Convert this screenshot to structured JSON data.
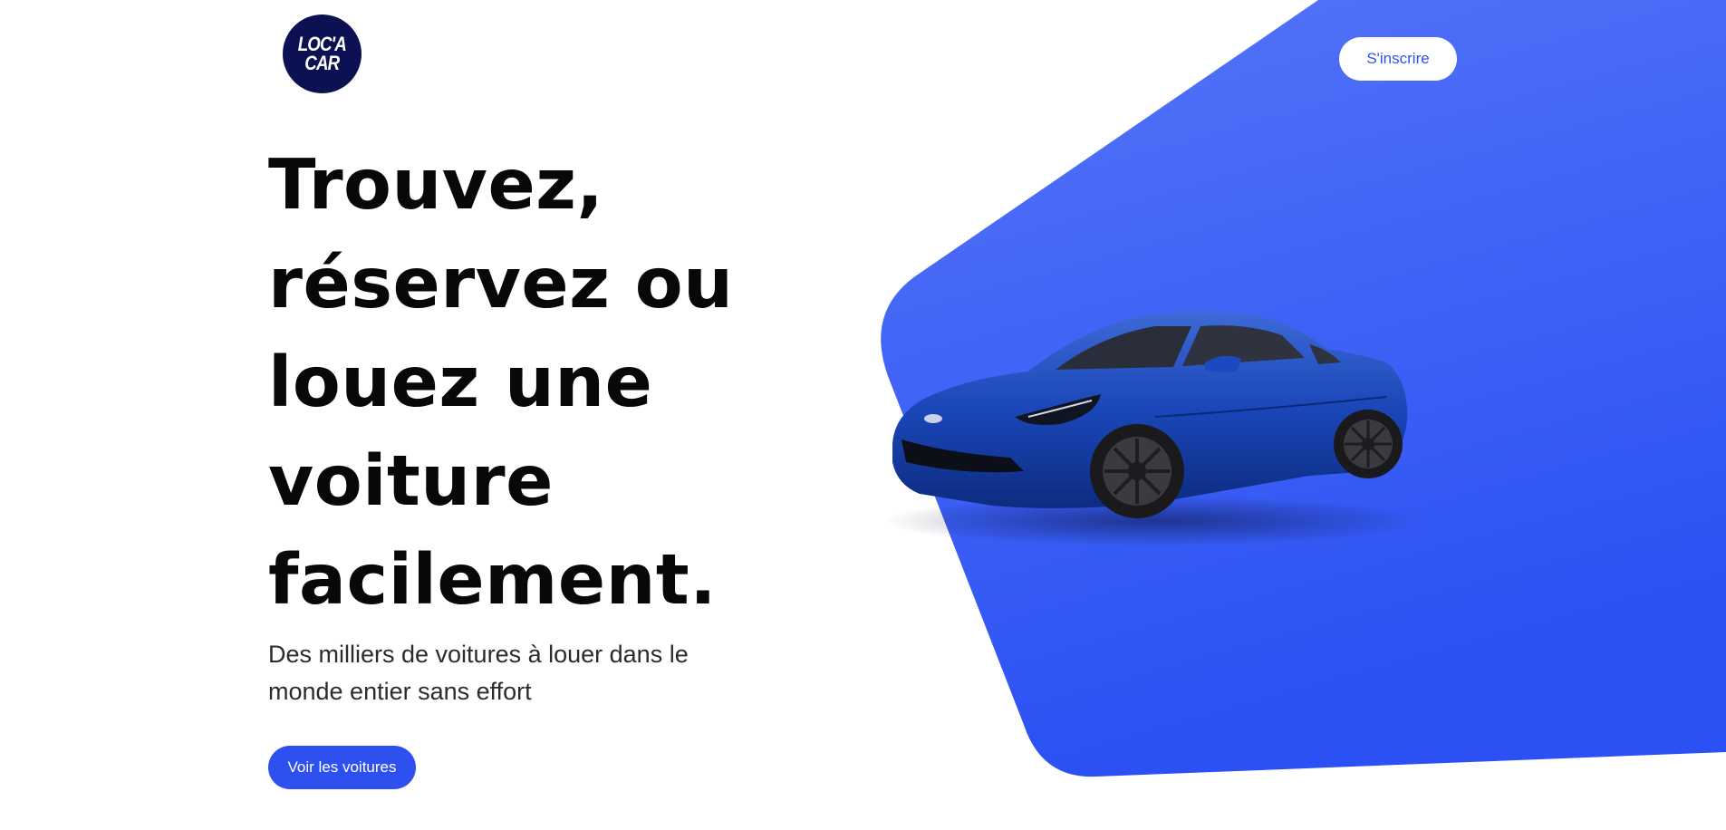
{
  "header": {
    "logo_line1": "LOC'A",
    "logo_line2": "CAR",
    "signup_label": "S'inscrire"
  },
  "hero": {
    "title_lines": [
      "Trouvez,",
      "réservez ou",
      "louez une",
      "voiture",
      "facilement."
    ],
    "subtitle_lines": [
      "Des milliers de voitures à louer dans le",
      "monde entier sans effort"
    ],
    "cta_label": "Voir les voitures"
  },
  "colors": {
    "brand_blue": "#2d50ee",
    "logo_navy": "#0b1152",
    "shape_gradient_top": "#5273f7",
    "shape_gradient_bottom": "#2c52f4"
  },
  "images": {
    "car": "blue sports coupe"
  }
}
